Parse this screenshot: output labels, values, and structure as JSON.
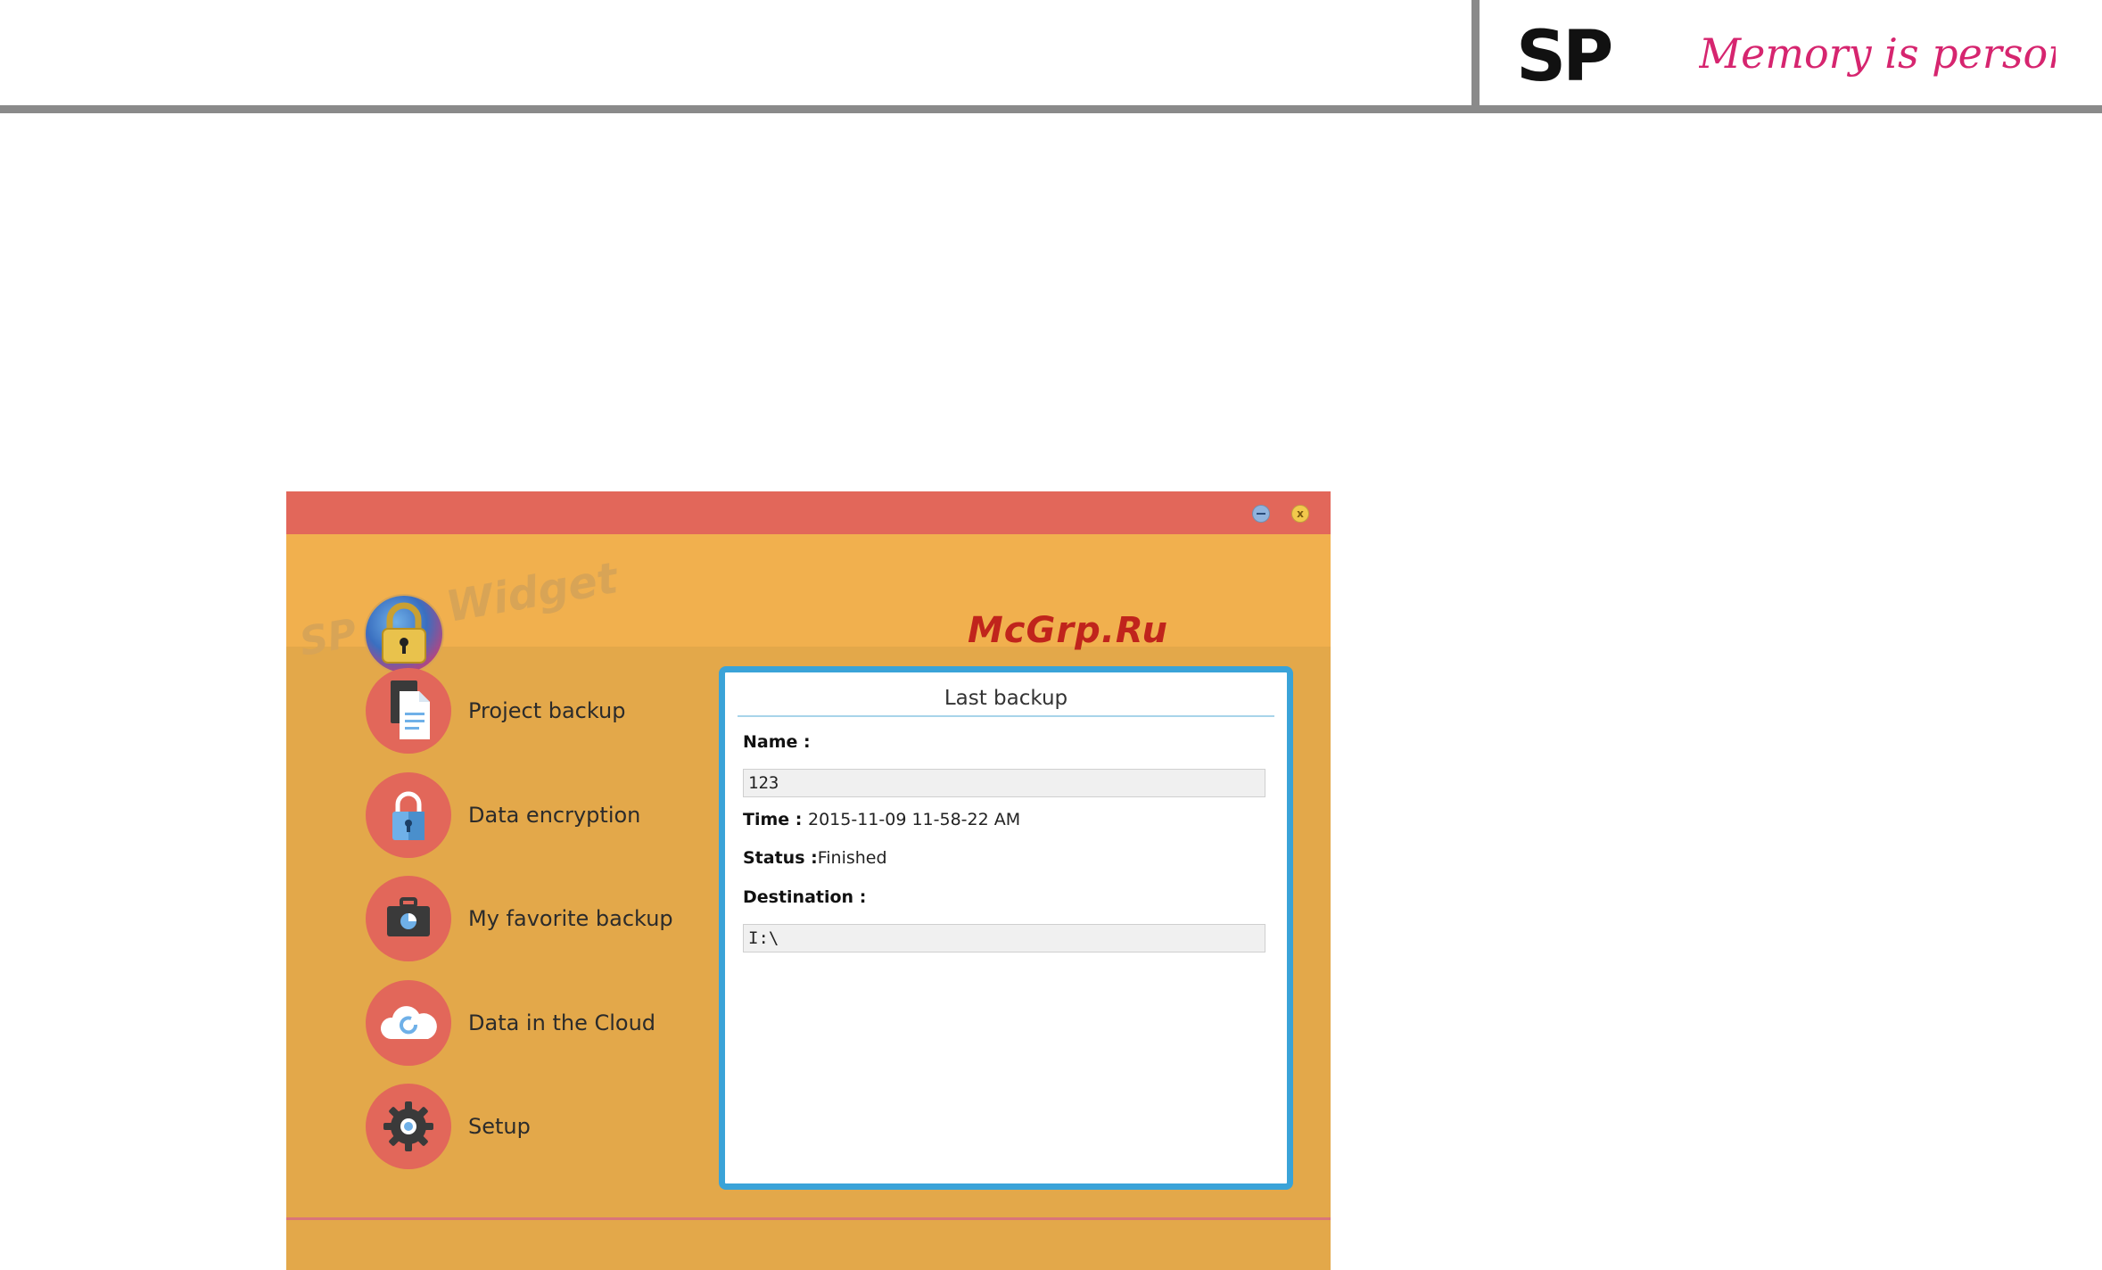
{
  "brand": {
    "logo_text": "SP",
    "slogan": "Memory is personal"
  },
  "watermark": "McGrp.Ru",
  "window": {
    "title_buttons": {
      "minimize_icon": "minimize-icon",
      "close_glyph": "x"
    },
    "app_logo": {
      "left": "SP",
      "right": "Widget",
      "icon": "padlock-globe-icon"
    }
  },
  "menu": {
    "items": [
      {
        "label": "Project backup",
        "icon": "document-icon"
      },
      {
        "label": "Data encryption",
        "icon": "padlock-icon"
      },
      {
        "label": "My favorite backup",
        "icon": "briefcase-icon"
      },
      {
        "label": "Data in the Cloud",
        "icon": "cloud-icon"
      },
      {
        "label": "Setup",
        "icon": "gear-icon"
      }
    ]
  },
  "last_backup": {
    "title": "Last backup",
    "name_label": "Name :",
    "name_value": "123",
    "time_label": "Time :",
    "time_value": "2015-11-09 11-58-22 AM",
    "status_label": "Status :",
    "status_value": "Finished",
    "destination_label": "Destination :",
    "destination_value": "I:\\"
  },
  "colors": {
    "titlebar": "#e2675a",
    "header": "#f1b04e",
    "body": "#e3a84a",
    "menu_circle": "#e2675a",
    "panel_border": "#3aa3d8",
    "slogan": "#d6256f"
  }
}
